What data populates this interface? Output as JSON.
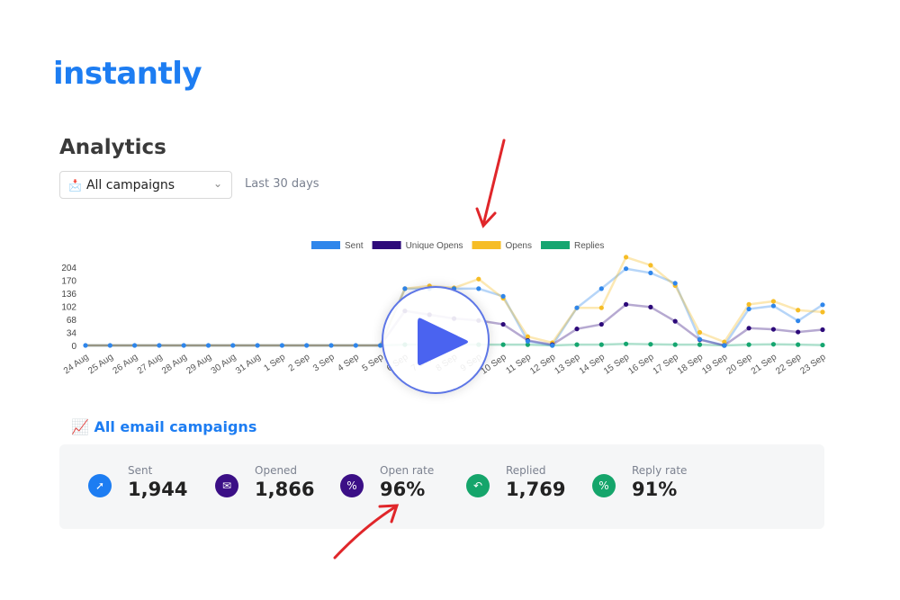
{
  "logo": "instantly",
  "page_title": "Analytics",
  "filter": {
    "campaign_select": "All campaigns",
    "range": "Last 30 days"
  },
  "chart_data": {
    "type": "line",
    "x": [
      "24 Aug",
      "25 Aug",
      "26 Aug",
      "27 Aug",
      "28 Aug",
      "29 Aug",
      "30 Aug",
      "31 Aug",
      "1 Sep",
      "2 Sep",
      "3 Sep",
      "4 Sep",
      "5 Sep",
      "6 Sep",
      "7 Sep",
      "8 Sep",
      "9 Sep",
      "10 Sep",
      "11 Sep",
      "12 Sep",
      "13 Sep",
      "14 Sep",
      "15 Sep",
      "16 Sep",
      "17 Sep",
      "18 Sep",
      "19 Sep",
      "20 Sep",
      "21 Sep",
      "22 Sep",
      "23 Sep"
    ],
    "yticks": [
      0,
      34,
      68,
      102,
      136,
      170,
      204
    ],
    "ylim": [
      0,
      238
    ],
    "legend_position": "top",
    "series": [
      {
        "name": "Sent",
        "color": "#2f86eb",
        "values": [
          0,
          0,
          0,
          0,
          0,
          0,
          0,
          0,
          0,
          0,
          0,
          0,
          0,
          148,
          148,
          148,
          148,
          128,
          11,
          0,
          98,
          148,
          200,
          189,
          162,
          16,
          0,
          95,
          103,
          64,
          106
        ]
      },
      {
        "name": "Unique Opens",
        "color": "#2d0a7a",
        "values": [
          0,
          0,
          0,
          0,
          0,
          0,
          0,
          0,
          0,
          0,
          0,
          0,
          0,
          90,
          80,
          70,
          65,
          55,
          13,
          2,
          43,
          55,
          107,
          100,
          63,
          15,
          0,
          45,
          42,
          35,
          41
        ]
      },
      {
        "name": "Opens",
        "color": "#f6bd26",
        "values": [
          0,
          0,
          0,
          0,
          0,
          0,
          0,
          0,
          0,
          0,
          0,
          0,
          0,
          148,
          155,
          150,
          173,
          123,
          23,
          7,
          98,
          98,
          230,
          209,
          156,
          34,
          9,
          107,
          115,
          92,
          87
        ]
      },
      {
        "name": "Replies",
        "color": "#16a670",
        "values": [
          0,
          0,
          0,
          0,
          0,
          0,
          0,
          0,
          0,
          0,
          0,
          0,
          0,
          2,
          2,
          2,
          2,
          2,
          2,
          0,
          2,
          2,
          4,
          3,
          2,
          2,
          0,
          2,
          3,
          2,
          1
        ]
      }
    ]
  },
  "section_title": "All email campaigns",
  "stats": [
    {
      "label": "Sent",
      "value": "1,944",
      "icon": "arrow-up-right-icon",
      "color": "#1d7df2"
    },
    {
      "label": "Opened",
      "value": "1,866",
      "icon": "envelope-open-icon",
      "color": "#3b0f86"
    },
    {
      "label": "Open rate",
      "value": "96%",
      "icon": "percent-icon",
      "color": "#3b0f86"
    },
    {
      "label": "Replied",
      "value": "1,769",
      "icon": "reply-icon",
      "color": "#15a56b"
    },
    {
      "label": "Reply rate",
      "value": "91%",
      "icon": "percent-icon",
      "color": "#15a56b"
    }
  ]
}
